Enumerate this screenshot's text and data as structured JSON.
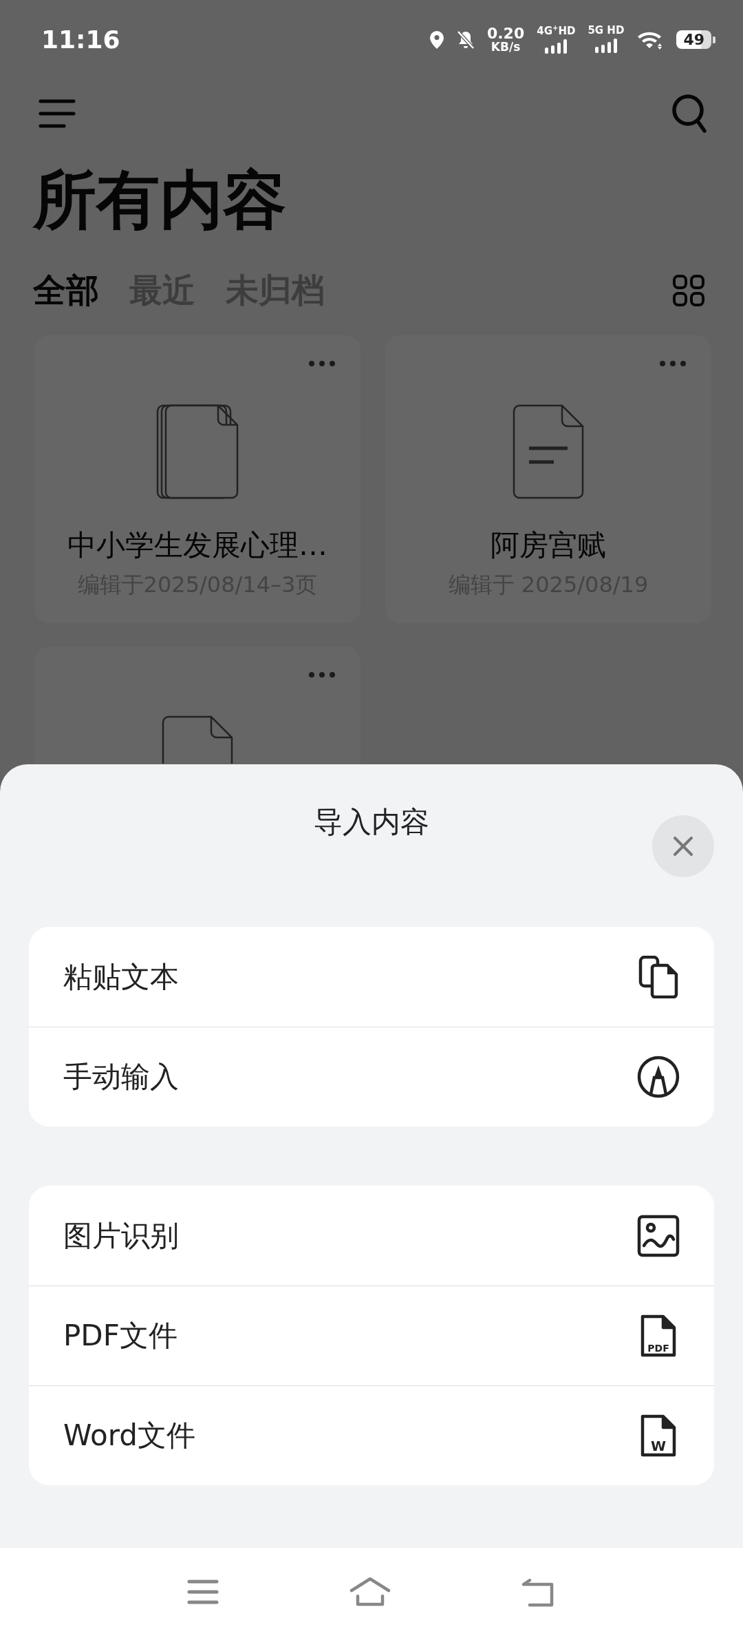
{
  "status_bar": {
    "time": "11:16",
    "speed_value": "0.20",
    "speed_unit": "KB/s",
    "sim1": "4G$^{+}$HD",
    "sim2": "5G HD",
    "battery": "49"
  },
  "header": {
    "title": "所有内容"
  },
  "tabs": [
    {
      "label": "全部",
      "selected": true
    },
    {
      "label": "最近",
      "selected": false
    },
    {
      "label": "未归档",
      "selected": false
    }
  ],
  "documents": [
    {
      "kind": "stack",
      "title": "中小学生发展心理…",
      "subtitle": "编辑于2025/08/14–3页"
    },
    {
      "kind": "text",
      "title": "阿房宫赋",
      "subtitle": "编辑于 2025/08/19"
    },
    {
      "kind": "blank"
    }
  ],
  "import_sheet": {
    "title": "导入内容",
    "groups": [
      [
        {
          "kind": "paste",
          "label": "粘贴文本"
        },
        {
          "kind": "pen",
          "label": "手动输入"
        }
      ],
      [
        {
          "kind": "image",
          "label": "图片识别"
        },
        {
          "kind": "pdf",
          "label": "PDF文件",
          "badge": "PDF"
        },
        {
          "kind": "word",
          "label": "Word文件",
          "badge": "W"
        }
      ]
    ]
  }
}
